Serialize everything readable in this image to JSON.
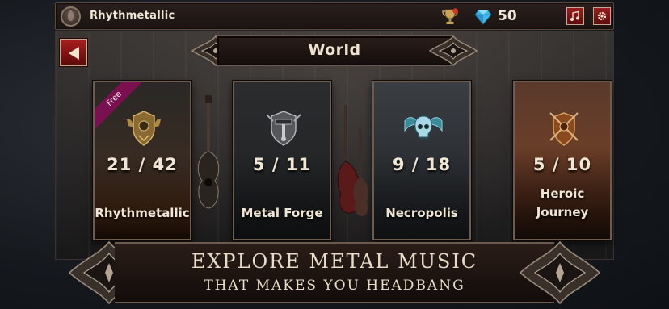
{
  "topbar": {
    "username": "Rhythmetallic",
    "gems": "50",
    "music_icon": "music-note-icon",
    "settings_icon": "gear-icon"
  },
  "header": {
    "title": "World"
  },
  "cards": [
    {
      "name": "Rhythmetallic",
      "progress": "21 / 42",
      "badge": "Free",
      "emblem": "dragon-crest-icon"
    },
    {
      "name": "Metal Forge",
      "progress": "5 / 11",
      "badge": "",
      "emblem": "forge-crest-icon"
    },
    {
      "name": "Necropolis",
      "progress": "9 / 18",
      "badge": "",
      "emblem": "skull-wings-icon"
    },
    {
      "name_line1": "Heroic",
      "name_line2": "Journey",
      "progress": "5 / 10",
      "badge": "",
      "emblem": "sword-shield-icon"
    }
  ],
  "banner": {
    "line1": "EXPLORE METAL MUSIC",
    "line2": "THAT MAKES YOU HEADBANG"
  },
  "colors": {
    "accent_red": "#9a1e1e",
    "free_ribbon": "#7a1050",
    "gem_blue": "#3fb7e8",
    "gold": "#c9a35a"
  }
}
